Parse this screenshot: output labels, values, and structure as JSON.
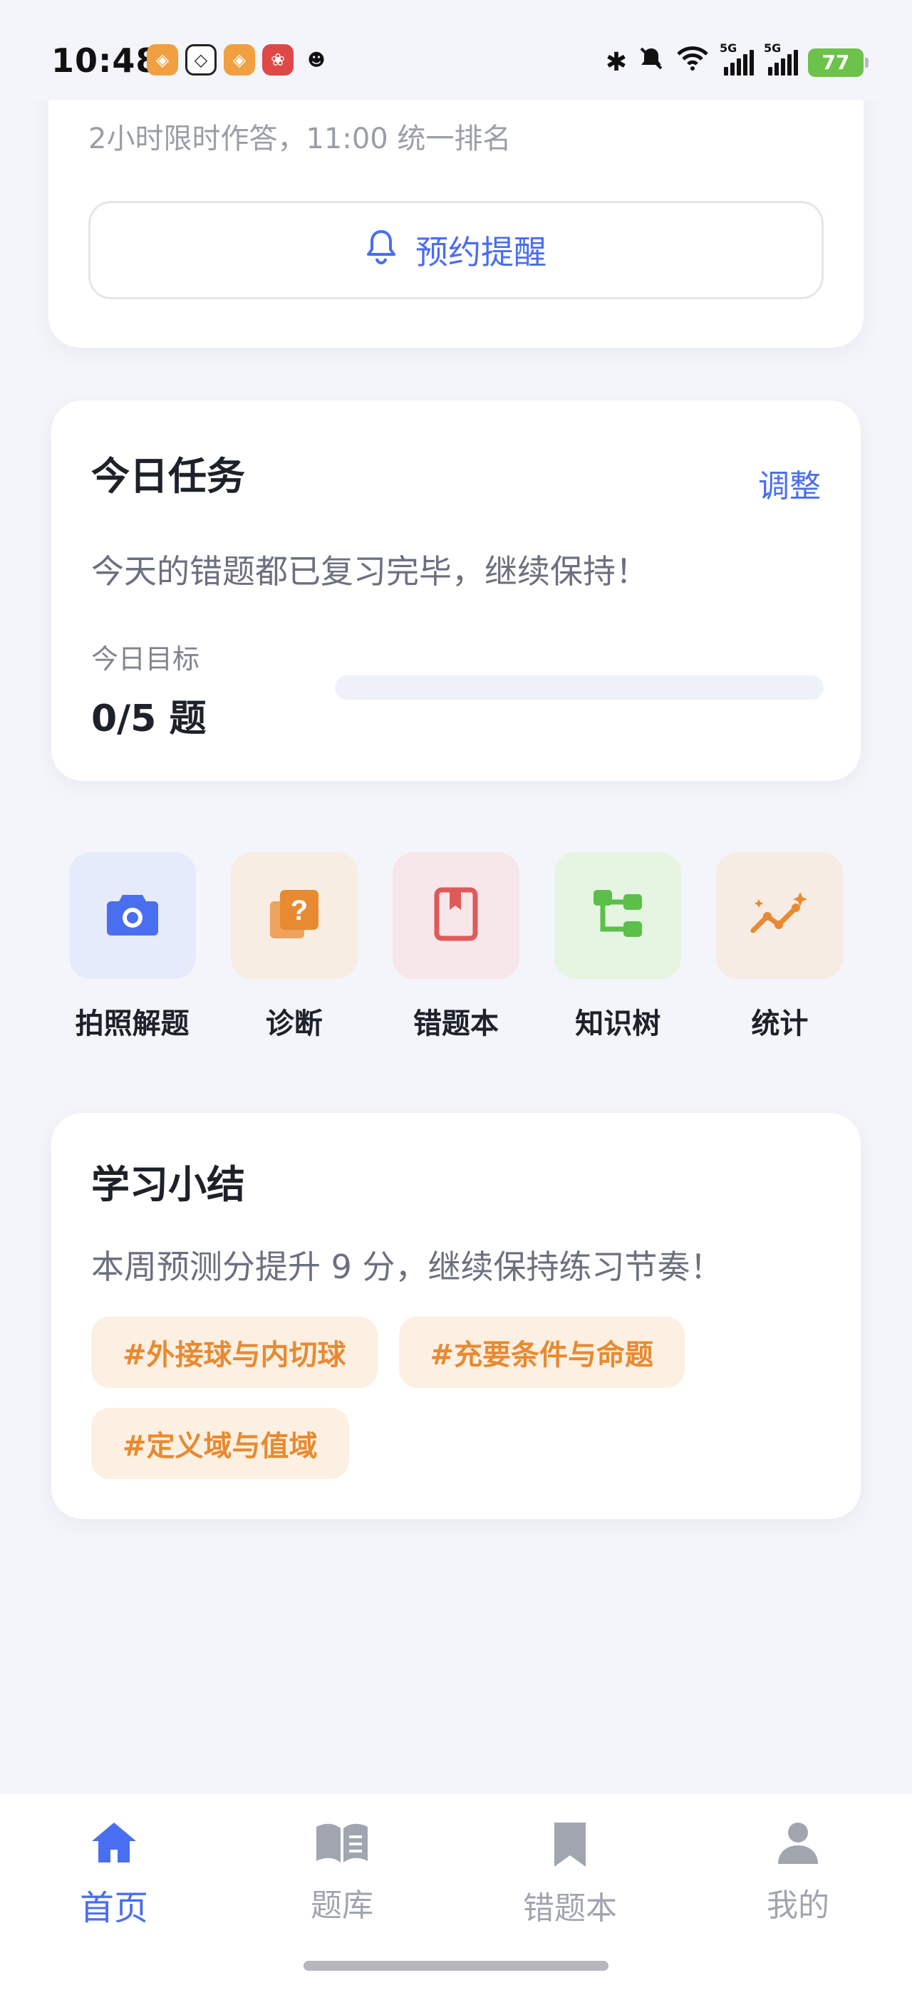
{
  "status_bar": {
    "time": "10:48",
    "battery": "77",
    "network_1": "5G",
    "network_2": "5G",
    "icons": [
      "bluetooth-icon",
      "mute-icon",
      "wifi-icon"
    ]
  },
  "contest": {
    "subtext": "2小时限时作答，11:00 统一排名",
    "remind_label": "预约提醒"
  },
  "today_task": {
    "title": "今日任务",
    "adjust_label": "调整",
    "description": "今天的错题都已复习完毕，继续保持！",
    "goal_label": "今日目标",
    "goal_value": "0/5 题",
    "progress": 0
  },
  "quick_actions": [
    {
      "label": "拍照解题",
      "icon": "camera-icon",
      "bg": "#e6ebfb",
      "color": "#4a6ef0"
    },
    {
      "label": "诊断",
      "icon": "question-card-icon",
      "bg": "#f7ede2",
      "color": "#e88a30"
    },
    {
      "label": "错题本",
      "icon": "book-icon",
      "bg": "#f7e6ea",
      "color": "#e05a5a"
    },
    {
      "label": "知识树",
      "icon": "tree-icon",
      "bg": "#e6f4e2",
      "color": "#5cbf4a"
    },
    {
      "label": "统计",
      "icon": "trend-icon",
      "bg": "#f7ece4",
      "color": "#e88a30"
    }
  ],
  "summary": {
    "title": "学习小结",
    "description": "本周预测分提升 9 分，继续保持练习节奏！",
    "tags": [
      "#外接球与内切球",
      "#充要条件与命题",
      "#定义域与值域"
    ]
  },
  "bottom_nav": [
    {
      "label": "首页",
      "icon": "home-icon",
      "active": true
    },
    {
      "label": "题库",
      "icon": "open-book-icon",
      "active": false
    },
    {
      "label": "错题本",
      "icon": "bookmark-icon",
      "active": false
    },
    {
      "label": "我的",
      "icon": "user-icon",
      "active": false
    }
  ],
  "colors": {
    "accent": "#4a6ef0",
    "orange": "#e88a30",
    "inactive": "#a0a5b0"
  }
}
